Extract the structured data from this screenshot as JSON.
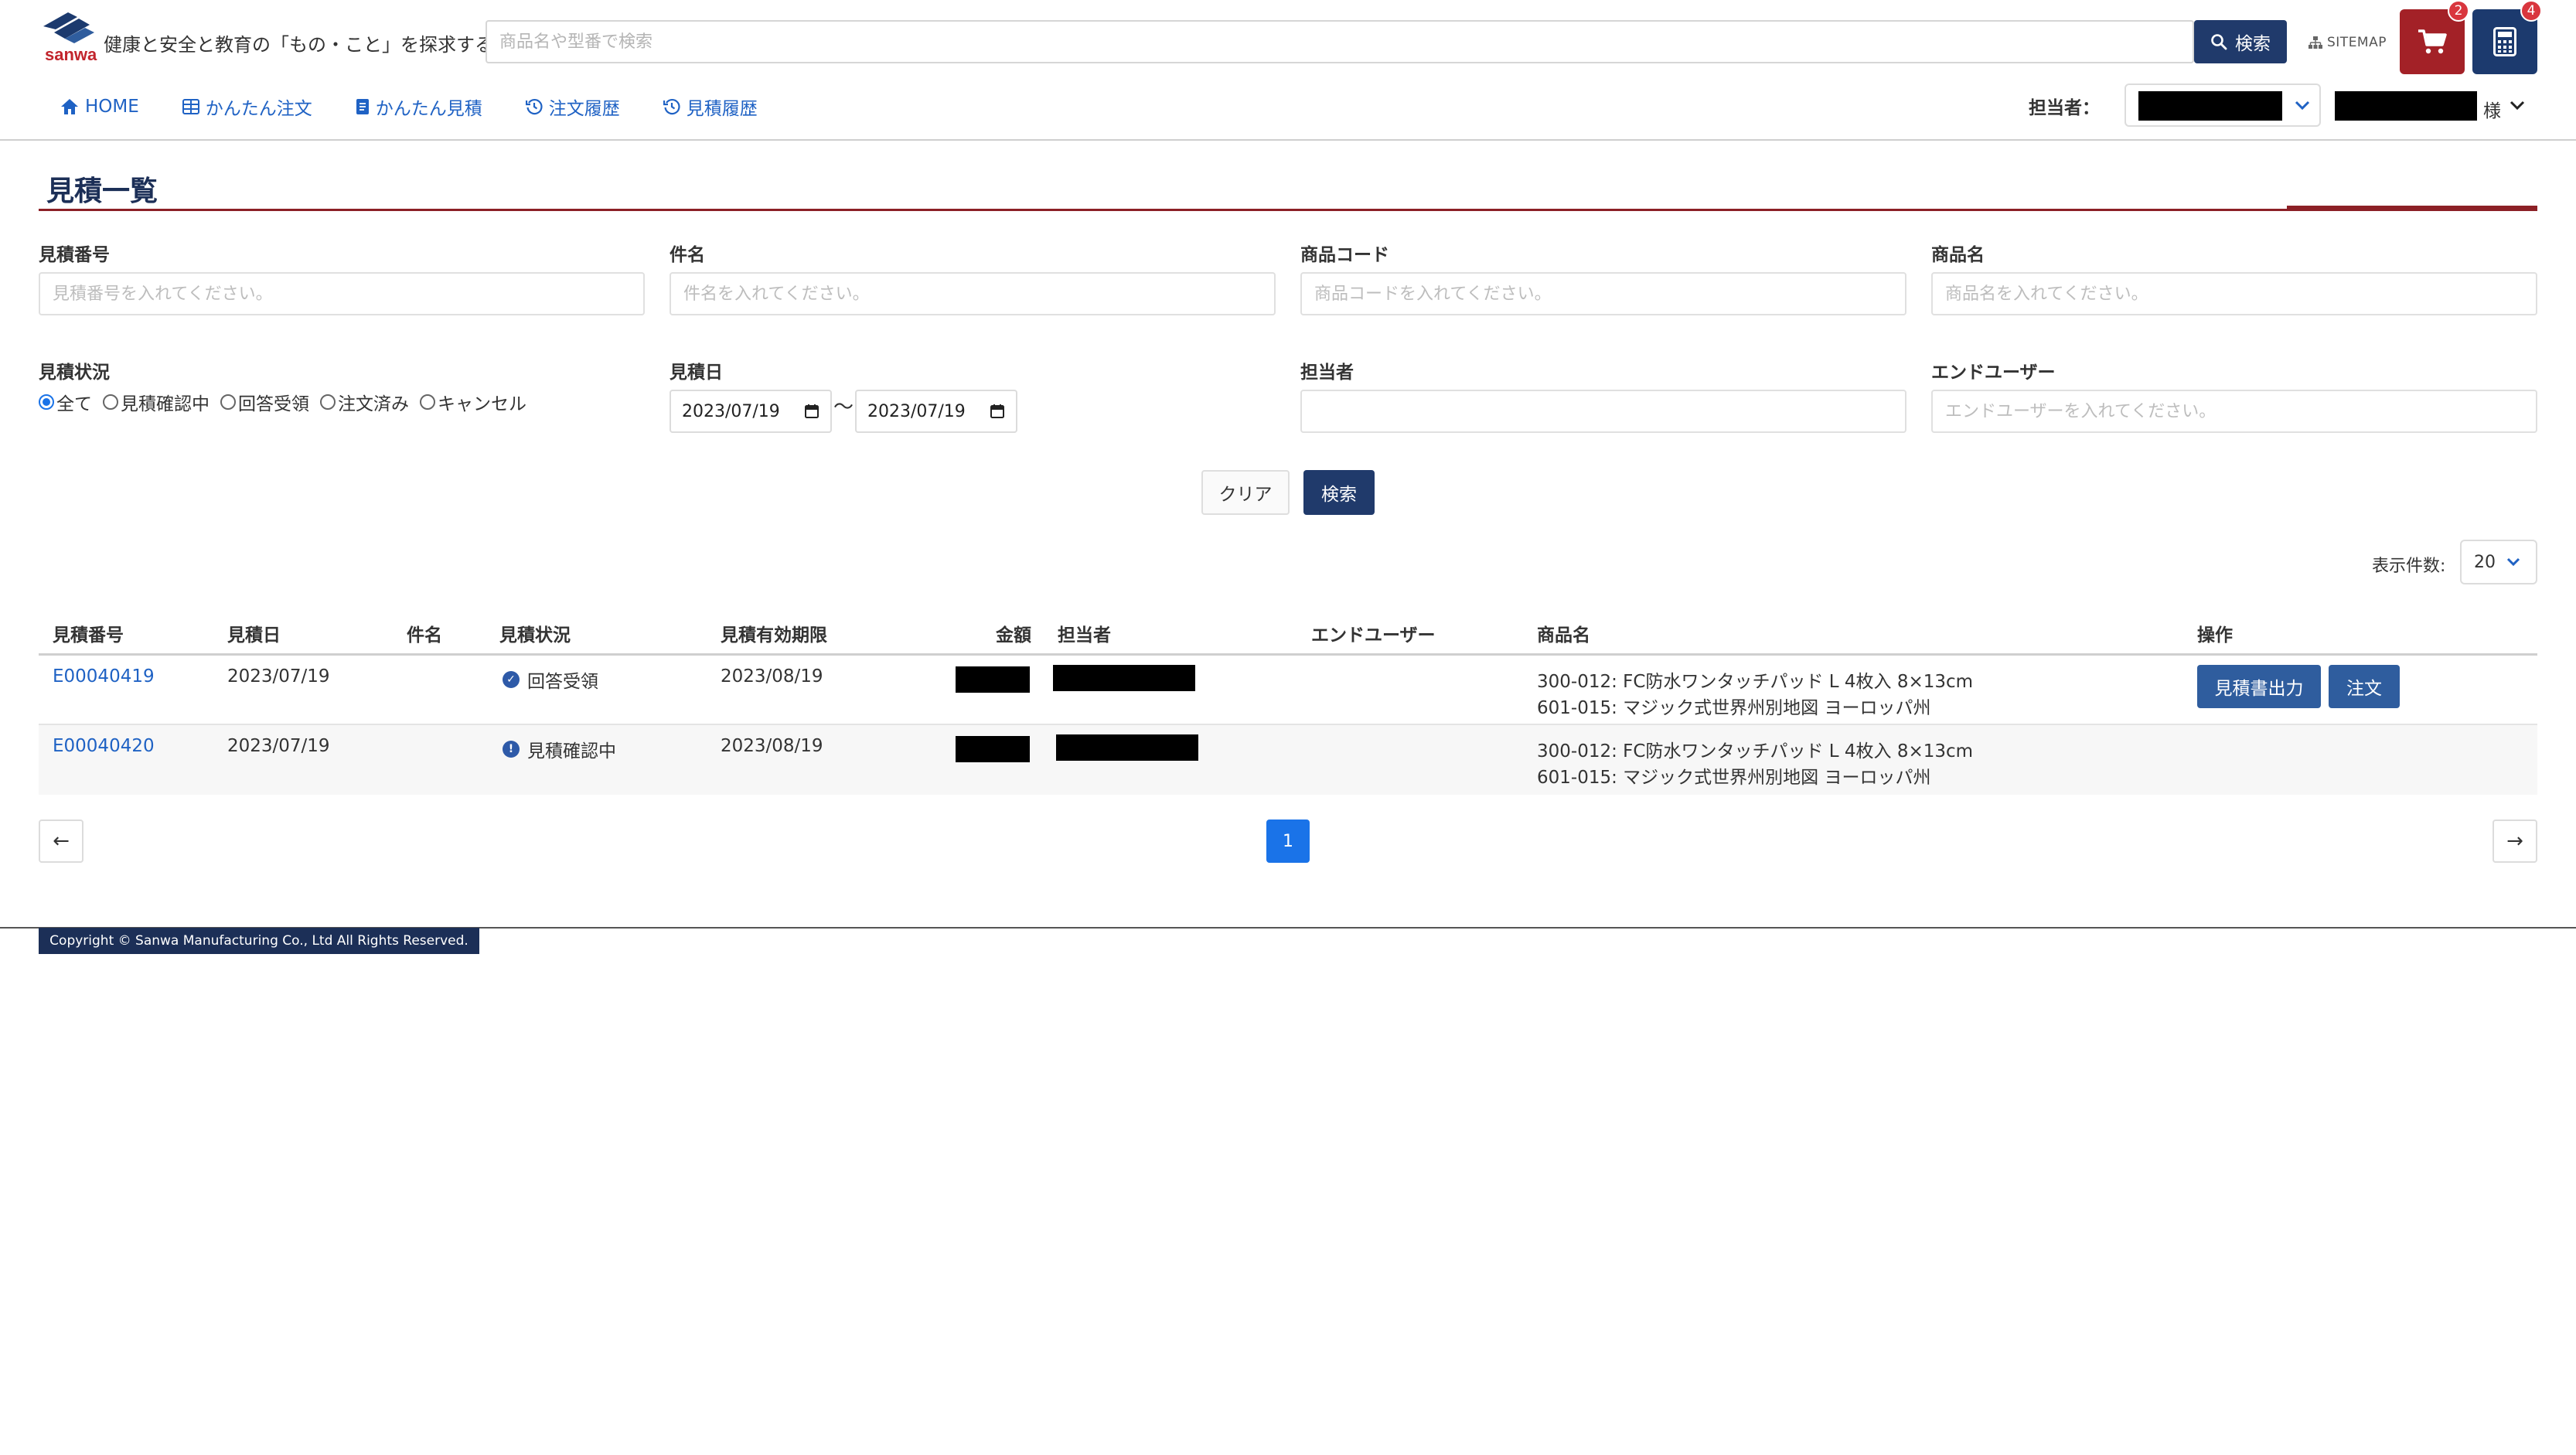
{
  "header": {
    "logo_text": "sanwa",
    "tagline": "健康と安全と教育の「もの・こと」を探求する",
    "search_placeholder": "商品名や型番で検索",
    "search_button": "検索",
    "sitemap": "SITEMAP",
    "cart_count": "2",
    "calc_count": "4"
  },
  "nav": [
    {
      "label": "HOME",
      "icon": "home-icon"
    },
    {
      "label": "かんたん注文",
      "icon": "grid-icon"
    },
    {
      "label": "かんたん見積",
      "icon": "document-icon"
    },
    {
      "label": "注文履歴",
      "icon": "history-icon"
    },
    {
      "label": "見積履歴",
      "icon": "history-icon"
    }
  ],
  "staff": {
    "label": "担当者："
  },
  "user": {
    "suffix": "様"
  },
  "page": {
    "title": "見積一覧"
  },
  "filters": {
    "quote_number": {
      "label": "見積番号",
      "placeholder": "見積番号を入れてください。",
      "value": ""
    },
    "subject": {
      "label": "件名",
      "placeholder": "件名を入れてください。",
      "value": ""
    },
    "product_code": {
      "label": "商品コード",
      "placeholder": "商品コードを入れてください。",
      "value": ""
    },
    "product_name": {
      "label": "商品名",
      "placeholder": "商品名を入れてください。",
      "value": ""
    },
    "status": {
      "label": "見積状況",
      "options": [
        "全て",
        "見積確認中",
        "回答受領",
        "注文済み",
        "キャンセル"
      ],
      "selected": "全て"
    },
    "quote_date": {
      "label": "見積日",
      "from": "2023/07/19",
      "to": "2023/07/19",
      "separator": "〜"
    },
    "staff": {
      "label": "担当者",
      "value": ""
    },
    "end_user": {
      "label": "エンドユーザー",
      "placeholder": "エンドユーザーを入れてください。",
      "value": ""
    },
    "clear_button": "クリア",
    "search_button": "検索"
  },
  "per_page": {
    "label": "表示件数:",
    "value": "20"
  },
  "table": {
    "columns": [
      "見積番号",
      "見積日",
      "件名",
      "見積状況",
      "見積有効期限",
      "金額",
      "担当者",
      "エンドユーザー",
      "商品名",
      "操作"
    ],
    "rows": [
      {
        "quote_number": "E00040419",
        "quote_date": "2023/07/19",
        "subject": "",
        "status": "回答受領",
        "status_icon": "check-circle-icon",
        "expiry": "2023/08/19",
        "end_user": "",
        "product_line1": "300-012: FC防水ワンタッチパッド L 4枚入 8×13cm",
        "product_line2": "601-015: マジック式世界州別地図 ヨーロッパ州",
        "actions": [
          "見積書出力",
          "注文"
        ]
      },
      {
        "quote_number": "E00040420",
        "quote_date": "2023/07/19",
        "subject": "",
        "status": "見積確認中",
        "status_icon": "exclamation-circle-icon",
        "expiry": "2023/08/19",
        "end_user": "",
        "product_line1": "300-012: FC防水ワンタッチパッド L 4枚入 8×13cm",
        "product_line2": "601-015: マジック式世界州別地図 ヨーロッパ州",
        "actions": []
      }
    ]
  },
  "pagination": {
    "prev": "←",
    "current": "1",
    "next": "→"
  },
  "footer": {
    "copyright": "Copyright © Sanwa Manufacturing Co., Ltd All Rights Reserved."
  },
  "colors": {
    "brand_navy": "#203a6b",
    "brand_red": "#a32127",
    "link_blue": "#1f62c4",
    "page_blue": "#1a73e8"
  }
}
